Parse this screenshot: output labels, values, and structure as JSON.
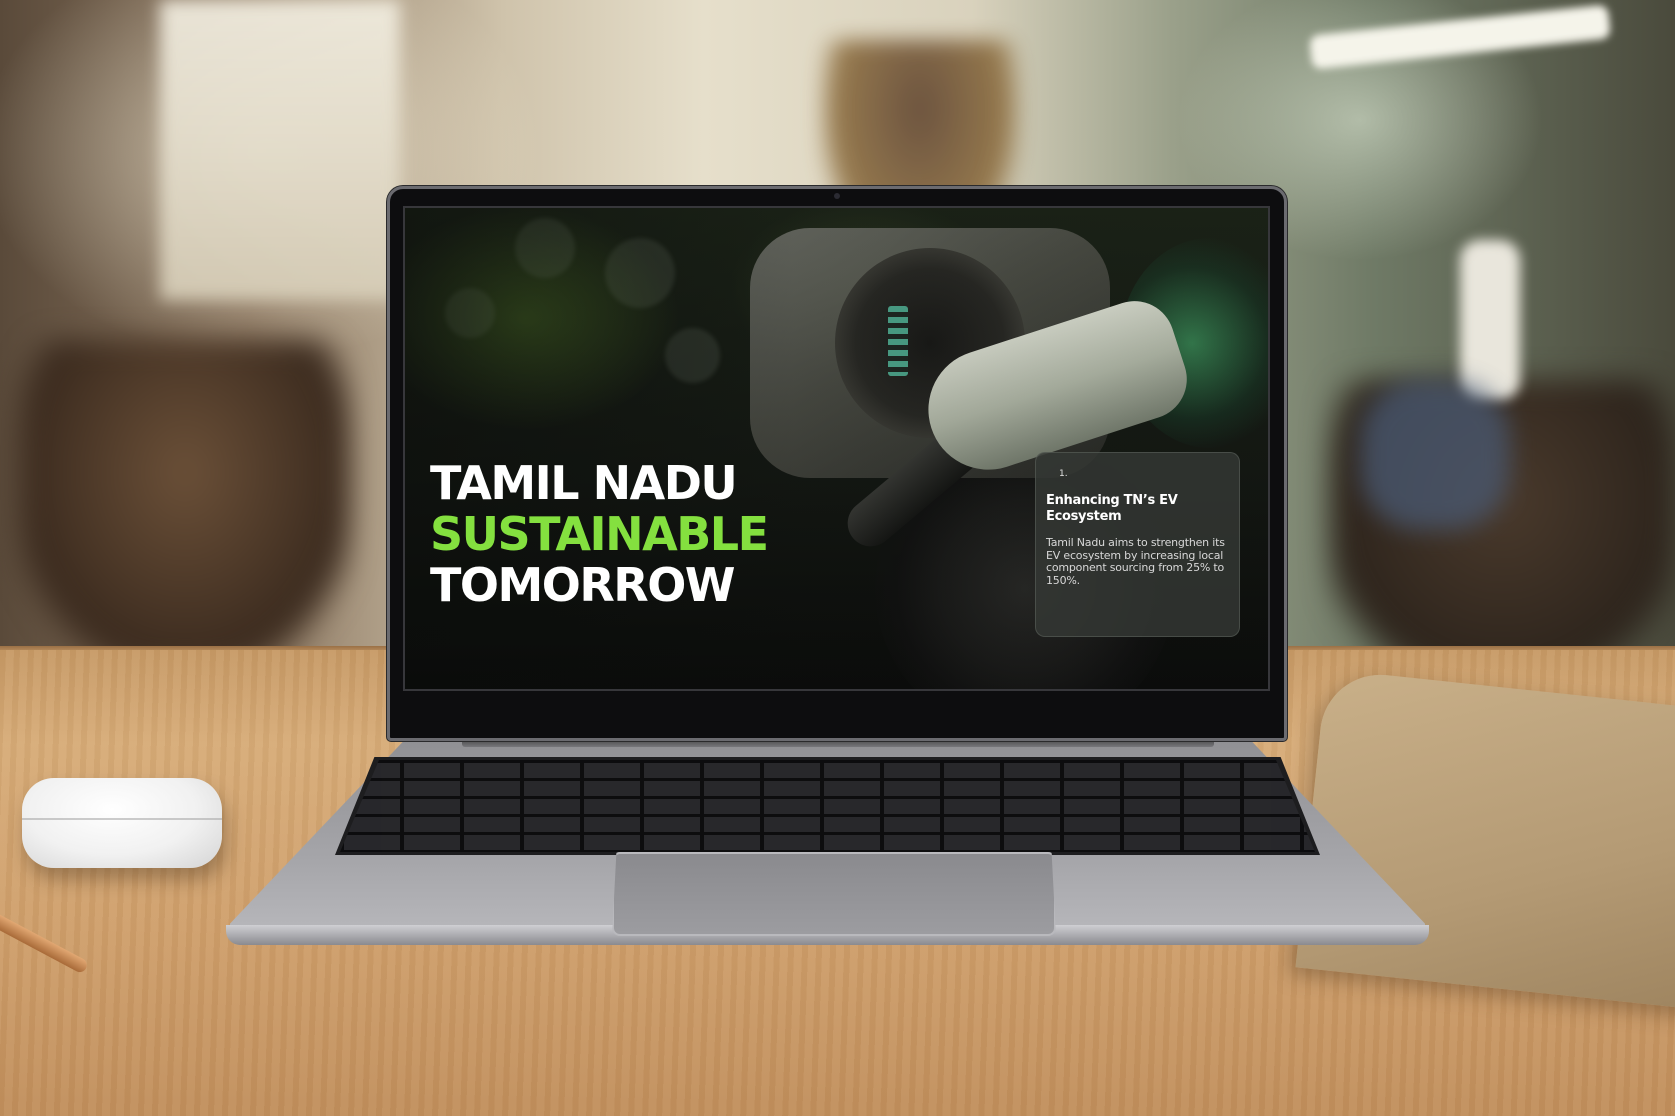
{
  "slide": {
    "headline": {
      "line1": "TAMIL NADU",
      "line2": "SUSTAINABLE",
      "line3": "TOMORROW"
    },
    "card": {
      "number": "1.",
      "title": "Enhancing TN’s EV Ecosystem",
      "body": "Tamil Nadu aims to strengthen its EV ecosystem by increasing local component sourcing from 25% to 150%."
    }
  },
  "colors": {
    "headline_white": "#ffffff",
    "headline_accent": "#84e03f",
    "card_background": "#343834"
  },
  "scene_objects": [
    "laptop",
    "wireless-earbuds-case",
    "pencil",
    "leather-folder",
    "wooden-table"
  ]
}
